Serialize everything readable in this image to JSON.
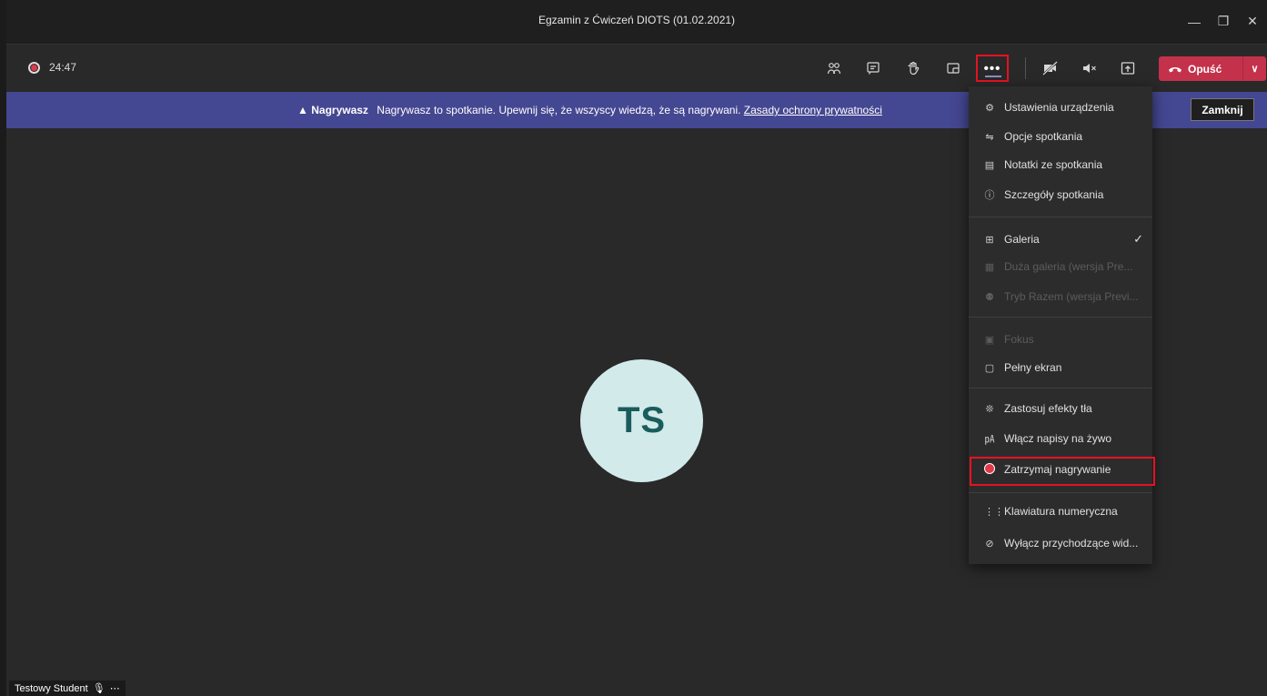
{
  "window": {
    "title": "Egzamin z Ćwiczeń DIOTS (01.02.2021)",
    "minimize": "—",
    "maximize": "❐",
    "close": "✕"
  },
  "toolbar": {
    "timer": "24:47",
    "more_label": "•••",
    "leave_label": "Opuść",
    "leave_chevron": "∨"
  },
  "banner": {
    "title": "Nagrywasz",
    "message": "Nagrywasz to spotkanie. Upewnij się, że wszyscy wiedzą, że są nagrywani.",
    "link": "Zasady ochrony prywatności",
    "dismiss": "Zamknij"
  },
  "stage": {
    "initials": "TS",
    "participant_name": "Testowy Student"
  },
  "menu": {
    "items": [
      {
        "label": "Ustawienia urządzenia",
        "icon": "gear-icon"
      },
      {
        "label": "Opcje spotkania",
        "icon": "options-icon"
      },
      {
        "label": "Notatki ze spotkania",
        "icon": "notes-icon"
      },
      {
        "label": "Szczegóły spotkania",
        "icon": "info-icon"
      },
      {
        "label": "Galeria",
        "icon": "grid-icon",
        "checked": true
      },
      {
        "label": "Duża galeria (wersja Pre...",
        "icon": "large-grid-icon",
        "disabled": true
      },
      {
        "label": "Tryb Razem (wersja Previ...",
        "icon": "together-icon",
        "disabled": true
      },
      {
        "label": "Fokus",
        "icon": "focus-icon",
        "disabled": true
      },
      {
        "label": "Pełny ekran",
        "icon": "fullscreen-icon"
      },
      {
        "label": "Zastosuj efekty tła",
        "icon": "background-icon"
      },
      {
        "label": "Włącz napisy na żywo",
        "icon": "captions-icon"
      },
      {
        "label": "Zatrzymaj nagrywanie",
        "icon": "record-icon"
      },
      {
        "label": "Klawiatura numeryczna",
        "icon": "dialpad-icon"
      },
      {
        "label": "Wyłącz przychodzące wid...",
        "icon": "video-off-icon"
      }
    ]
  },
  "colors": {
    "accent": "#444791",
    "leave": "#c4314b",
    "highlight": "#e81123",
    "avatar_bg": "#d3eaea"
  }
}
